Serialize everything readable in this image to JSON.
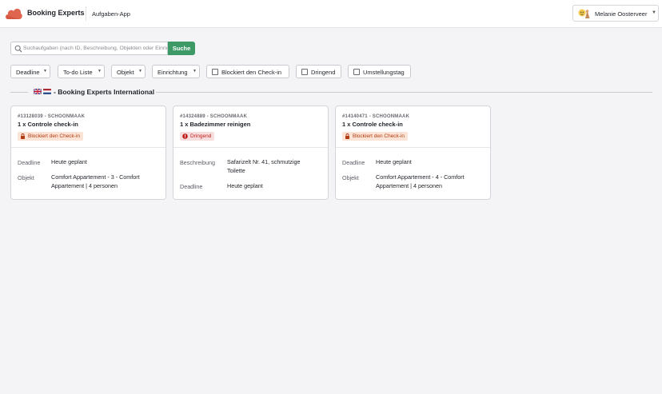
{
  "header": {
    "brand": "Booking Experts",
    "app_name": "Aufgaben-App",
    "user_name": "Melanie Oosterveer"
  },
  "search": {
    "placeholder": "Suchaufgaben (nach ID, Beschreibung, Objekten oder Einrichtungen)",
    "value": "",
    "button_label": "Suche"
  },
  "filters": {
    "deadline": "Deadline",
    "todo_list": "To-do Liste",
    "objekt": "Objekt",
    "einrichtung": "Einrichtung",
    "blockiert": "Blockiert den Check-in",
    "dringend": "Dringend",
    "umstellungstag": "Umstellungstag"
  },
  "group": {
    "title": "- Booking Experts International",
    "flags": [
      "gb-flag-icon",
      "nl-flag-icon"
    ]
  },
  "labels": {
    "deadline": "Deadline",
    "objekt": "Objekt",
    "beschreibung": "Beschreibung"
  },
  "cards": [
    {
      "sub": "#13128039 - SCHOONMAAK",
      "title": "1 x Controle check-in",
      "badge": "Blockiert den Check-in",
      "badge_icon": "lock-icon",
      "deadline": "Heute geplant",
      "objekt_line1": "Comfort Appartement - 3 - Comfort",
      "objekt_line2": "Appartement | 4 personen"
    },
    {
      "sub": "#14324889 - SCHOONMAAK",
      "title": "1 x Badezimmer reinigen",
      "badge": "Dringend",
      "badge_icon": "alert-icon",
      "beschreibung_line1": "Safarizelt Nr. 41, schmutzige",
      "beschreibung_line2": "Toilette",
      "deadline": "Heute geplant"
    },
    {
      "sub": "#14140471 - SCHOONMAAK",
      "title": "1 x Controle check-in",
      "badge": "Blockiert den Check-in",
      "badge_icon": "lock-icon",
      "deadline": "Heute geplant",
      "objekt_line1": "Comfort Appartement - 4 - Comfort",
      "objekt_line2": "Appartement | 4 personen"
    }
  ],
  "colors": {
    "accent": "#3d9a66",
    "blocked_bg": "#fbe3d6",
    "blocked_text": "#b23d12",
    "urgent_bg": "#f7dede",
    "urgent_text": "#c0201c",
    "logo": "#e0654e"
  }
}
